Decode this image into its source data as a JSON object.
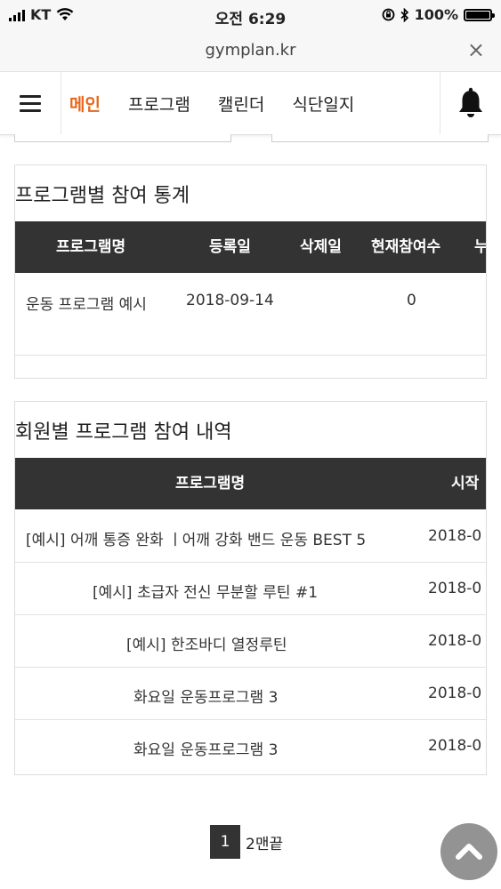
{
  "status_bar": {
    "carrier": "KT",
    "time": "오전 6:29",
    "battery_percent": "100%"
  },
  "url_bar": {
    "url": "gymplan.kr",
    "close_label": "×"
  },
  "nav": {
    "items": [
      {
        "label": "메인",
        "active": true
      },
      {
        "label": "프로그램",
        "active": false
      },
      {
        "label": "캘린더",
        "active": false
      },
      {
        "label": "식단일지",
        "active": false
      }
    ],
    "accent_color": "#e8661b",
    "icons": [
      "hamburger-icon",
      "bell-icon"
    ]
  },
  "program_stats": {
    "title": "프로그램별 참여 통계",
    "columns": [
      "프로그램명",
      "등록일",
      "삭제일",
      "현재참여수",
      "누"
    ],
    "rows": [
      {
        "name": "운동 프로그램 예시",
        "registered": "2018-09-14",
        "deleted": "",
        "current": "0"
      }
    ]
  },
  "member_history": {
    "title": "회원별 프로그램 참여 내역",
    "columns": [
      "프로그램명",
      "시작"
    ],
    "rows": [
      {
        "name": "[예시] 어깨 통증 완화 ㅣ어깨 강화 밴드 운동 BEST 5",
        "start": "2018-0"
      },
      {
        "name": "[예시] 초급자 전신 무분할 루틴 #1",
        "start": "2018-0"
      },
      {
        "name": "[예시] 한조바디 열정루틴",
        "start": "2018-0"
      },
      {
        "name": "화요일 운동프로그램 3",
        "start": "2018-0"
      },
      {
        "name": "화요일 운동프로그램 3",
        "start": "2018-0"
      }
    ]
  },
  "pagination": {
    "current": "1",
    "next_label": "2맨끝"
  },
  "scroll_top_icon": "chevron-up-icon"
}
